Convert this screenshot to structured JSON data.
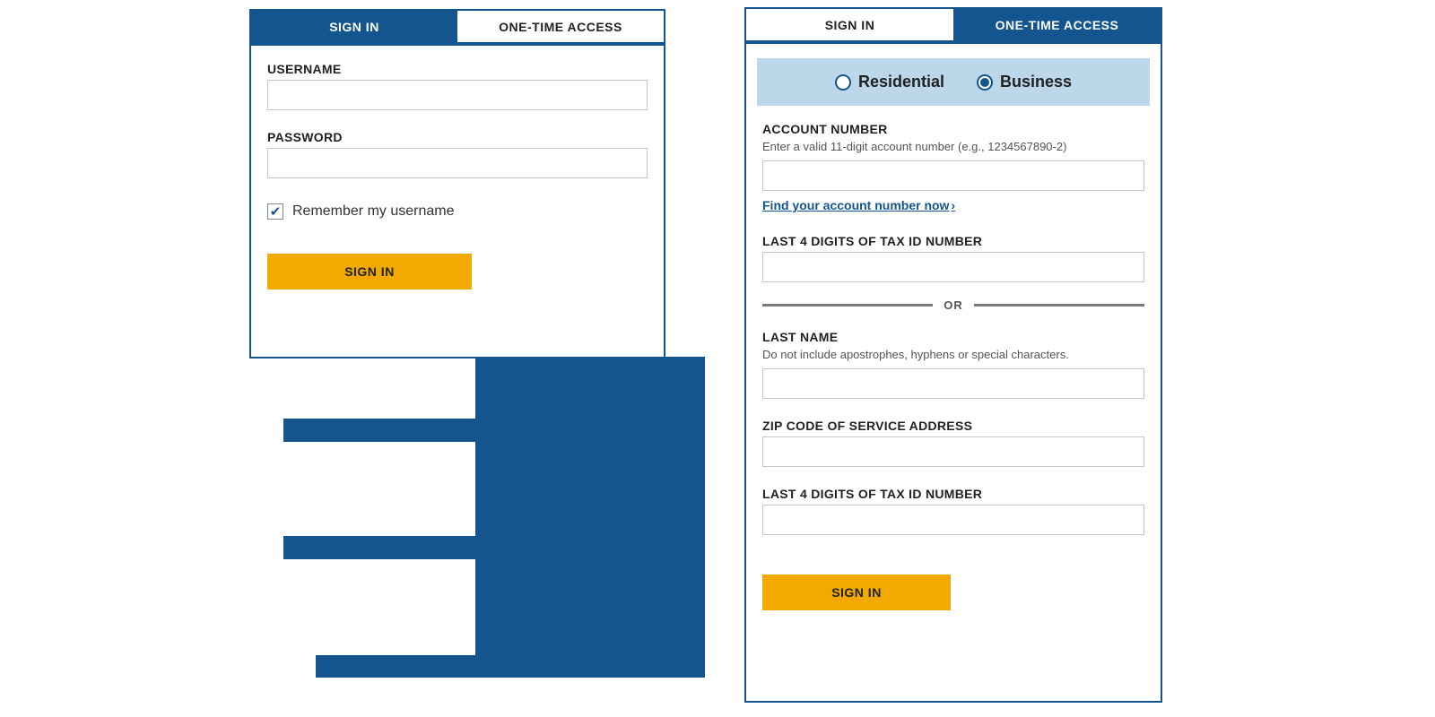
{
  "left": {
    "tabs": {
      "signin": "SIGN IN",
      "onetime": "ONE-TIME ACCESS"
    },
    "username_label": "USERNAME",
    "password_label": "PASSWORD",
    "remember_label": "Remember my username",
    "remember_checked": true,
    "signin_button": "SIGN IN"
  },
  "right": {
    "tabs": {
      "signin": "SIGN IN",
      "onetime": "ONE-TIME ACCESS"
    },
    "radio": {
      "residential": "Residential",
      "business": "Business",
      "selected": "business"
    },
    "account_number_label": "ACCOUNT NUMBER",
    "account_number_help": "Enter a valid 11-digit account number (e.g., 1234567890-2)",
    "find_account_link": "Find your account number now",
    "tax4_label_1": "LAST 4 DIGITS OF TAX ID NUMBER",
    "or_text": "OR",
    "lastname_label": "LAST NAME",
    "lastname_help": "Do not include apostrophes, hyphens or special characters.",
    "zip_label": "ZIP CODE OF SERVICE ADDRESS",
    "tax4_label_2": "LAST 4 DIGITS OF TAX ID NUMBER",
    "signin_button": "SIGN IN"
  }
}
